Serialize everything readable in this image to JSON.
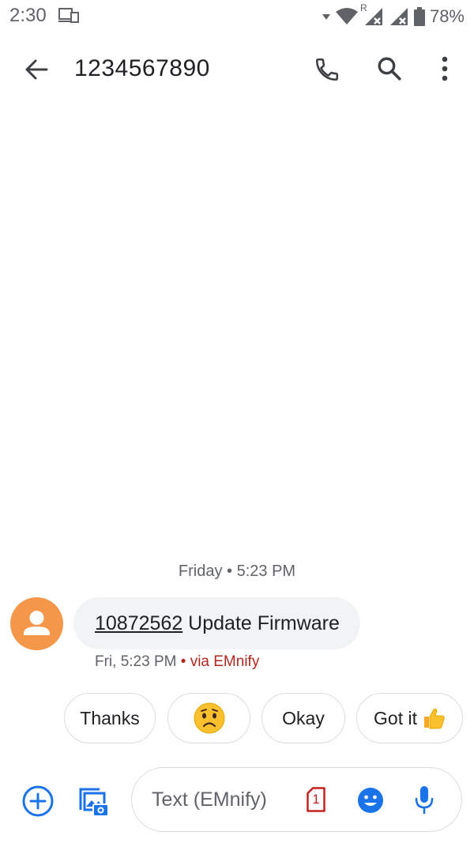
{
  "status_bar": {
    "time": "2:30",
    "battery_text": "78%",
    "icons": [
      "cast-icon",
      "wifi-icon",
      "roaming-indicator",
      "signal-icon",
      "signal-icon",
      "battery-icon"
    ],
    "roaming_label": "R"
  },
  "app_bar": {
    "title": "1234567890",
    "icons": [
      "back-arrow-icon",
      "phone-icon",
      "search-icon",
      "more-vert-icon"
    ]
  },
  "conversation": {
    "date_divider": "Friday • 5:23 PM",
    "messages": [
      {
        "sender_avatar": "person-icon",
        "link_number": "10872562",
        "text": " Update Firmware",
        "meta_time": "Fri, 5:23 PM",
        "meta_via": " • via EMnify"
      }
    ]
  },
  "smart_replies": [
    {
      "label": "Thanks"
    },
    {
      "label": "",
      "icon": "worried-emoji-icon"
    },
    {
      "label": "Okay"
    },
    {
      "label": "Got it",
      "icon": "thumbs-up-emoji-icon"
    }
  ],
  "compose": {
    "placeholder": "Text (EMnify)",
    "sim_number": "1",
    "icons": [
      "add-icon",
      "gallery-camera-icon",
      "sim-card-icon",
      "emoji-icon",
      "mic-icon"
    ]
  },
  "colors": {
    "accent_blue": "#1a73e8",
    "avatar_orange": "#f4974a",
    "bubble_gray": "#f1f3f4",
    "via_red": "#b3261e",
    "sim_red": "#c5221f"
  }
}
